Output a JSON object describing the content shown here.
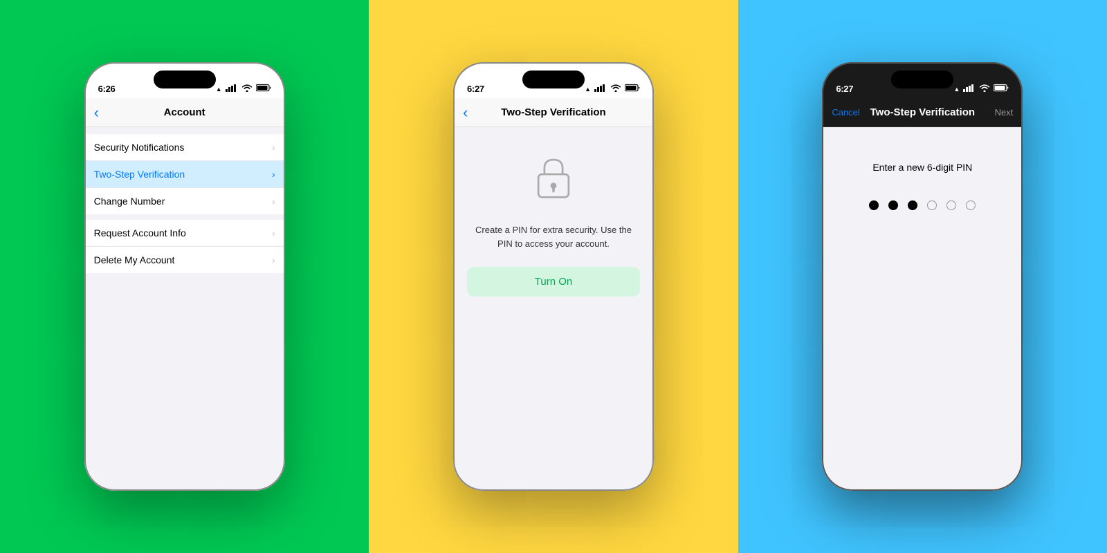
{
  "backgrounds": {
    "phone1": "#00C853",
    "phone2": "#FFD740",
    "phone3": "#40C4FF"
  },
  "phone1": {
    "status": {
      "time": "6:26",
      "location_icon": "▲",
      "signal": "▌▌▌▌",
      "wifi": "WiFi",
      "battery": "▓"
    },
    "nav": {
      "title": "Account",
      "back_icon": "‹"
    },
    "sections": [
      {
        "items": [
          {
            "label": "Security Notifications",
            "active": false
          },
          {
            "label": "Two-Step Verification",
            "active": true
          },
          {
            "label": "Change Number",
            "active": false
          }
        ]
      },
      {
        "items": [
          {
            "label": "Request Account Info",
            "active": false
          },
          {
            "label": "Delete My Account",
            "active": false
          }
        ]
      }
    ]
  },
  "phone2": {
    "status": {
      "time": "6:27",
      "location_icon": "▲",
      "signal": "▌▌▌▌",
      "wifi": "WiFi",
      "battery": "▓"
    },
    "nav": {
      "title": "Two-Step Verification",
      "back_icon": "‹"
    },
    "description": "Create a PIN for extra security. Use the PIN to access your account.",
    "turn_on_label": "Turn On"
  },
  "phone3": {
    "status": {
      "time": "6:27",
      "location_icon": "▲",
      "signal": "▌▌▌▌",
      "wifi": "WiFi",
      "battery": "▓"
    },
    "nav": {
      "title": "Two-Step Verification",
      "cancel_label": "Cancel",
      "next_label": "Next"
    },
    "pin_label": "Enter a new 6-digit PIN",
    "pin_filled": 3,
    "pin_total": 6
  }
}
